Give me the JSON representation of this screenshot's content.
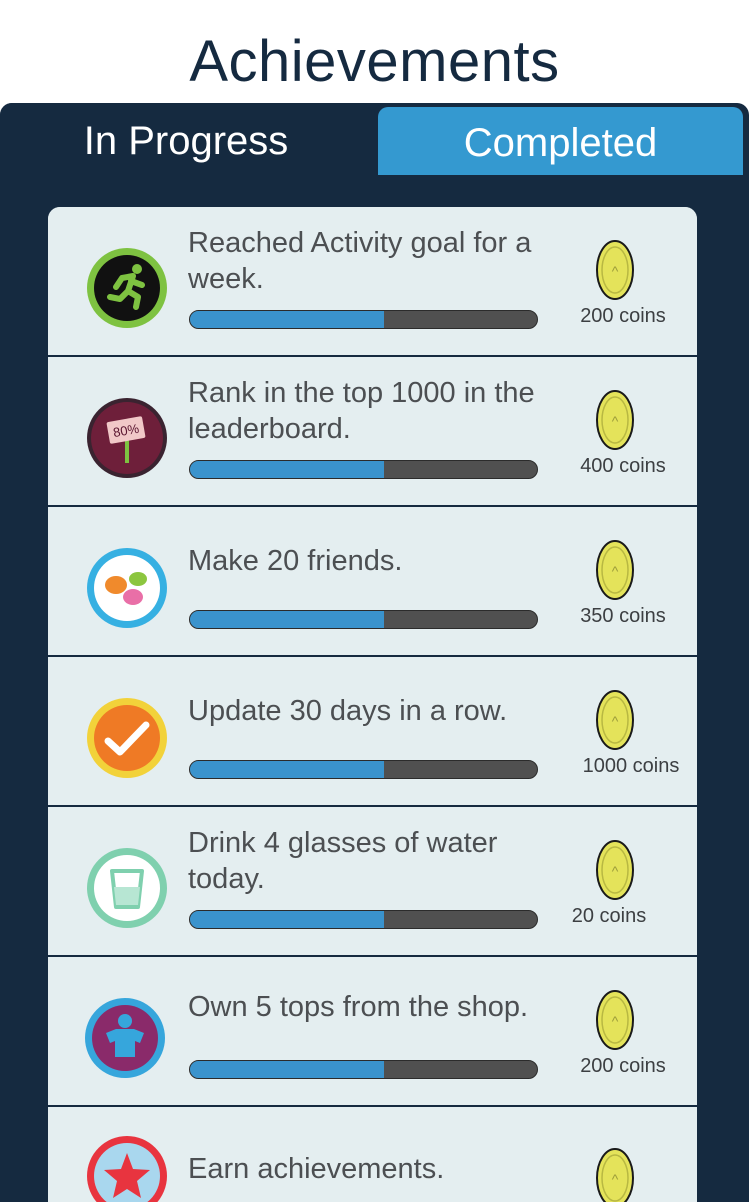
{
  "header": {
    "title": "Achievements"
  },
  "tabs": {
    "in_progress": "In Progress",
    "completed": "Completed"
  },
  "achievements": [
    {
      "text": "Reached Activity goal for a week.",
      "reward": "200 coins",
      "progress": 0.56,
      "icon": "running-man-icon"
    },
    {
      "text": "Rank in the top 1000 in the leaderboard.",
      "reward": "400 coins",
      "progress": 0.56,
      "icon": "sign-80-percent-icon",
      "icon_label": "80%"
    },
    {
      "text": "Make 20 friends.",
      "reward": "350 coins",
      "progress": 0.56,
      "icon": "chat-bubbles-icon"
    },
    {
      "text": "Update 30 days in a row.",
      "reward": "1000 coins",
      "progress": 0.56,
      "icon": "checkmark-icon"
    },
    {
      "text": "Drink 4 glasses of water today.",
      "reward": "20 coins",
      "progress": 0.56,
      "icon": "water-glass-icon"
    },
    {
      "text": "Own 5 tops from the shop.",
      "reward": "200 coins",
      "progress": 0.56,
      "icon": "shirt-person-icon"
    },
    {
      "text": "Earn achievements.",
      "reward": "",
      "progress": null,
      "icon": "star-icon"
    }
  ],
  "colors": {
    "navy": "#152a40",
    "tab_active_blue": "#3499d0",
    "progress_fill": "#3a93cd",
    "progress_track": "#505050",
    "coin_yellow": "#e4e35a"
  }
}
